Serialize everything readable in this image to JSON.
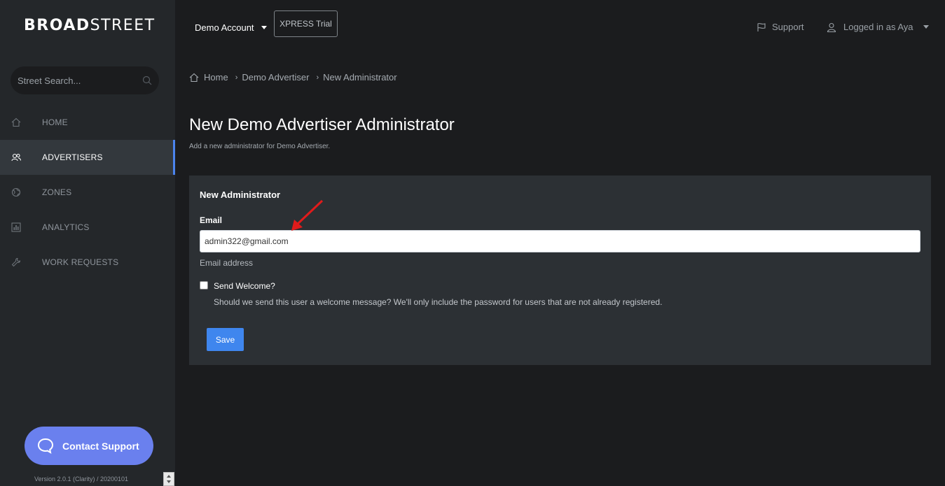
{
  "logo": {
    "bold": "BROAD",
    "light": "STREET"
  },
  "search": {
    "placeholder": "Street Search..."
  },
  "sidebar": {
    "items": [
      {
        "label": "HOME",
        "icon": "home-icon",
        "active": false
      },
      {
        "label": "ADVERTISERS",
        "icon": "users-icon",
        "active": true
      },
      {
        "label": "ZONES",
        "icon": "globe-icon",
        "active": false
      },
      {
        "label": "ANALYTICS",
        "icon": "chart-icon",
        "active": false
      },
      {
        "label": "WORK REQUESTS",
        "icon": "wrench-icon",
        "active": false
      }
    ],
    "contact_label": "Contact Support",
    "version": "Version 2.0.1 (Clarity) / 20200101"
  },
  "topbar": {
    "account": "Demo Account",
    "xpress": "XPRESS Trial",
    "support": "Support",
    "user": "Logged in as Aya"
  },
  "breadcrumb": {
    "home": "Home",
    "advertiser": "Demo Advertiser",
    "current": "New Administrator"
  },
  "page": {
    "title": "New Demo Advertiser Administrator",
    "subtitle": "Add a new administrator for Demo Advertiser."
  },
  "form": {
    "card_title": "New Administrator",
    "email_label": "Email",
    "email_value": "admin322@gmail.com",
    "email_help": "Email address",
    "welcome_label": "Send Welcome?",
    "welcome_help": "Should we send this user a welcome message? We'll only include the password for users that are not already registered.",
    "save_label": "Save"
  },
  "colors": {
    "accent": "#3f86ee",
    "contact": "#6a80ee",
    "annotation": "#e01b1b"
  }
}
